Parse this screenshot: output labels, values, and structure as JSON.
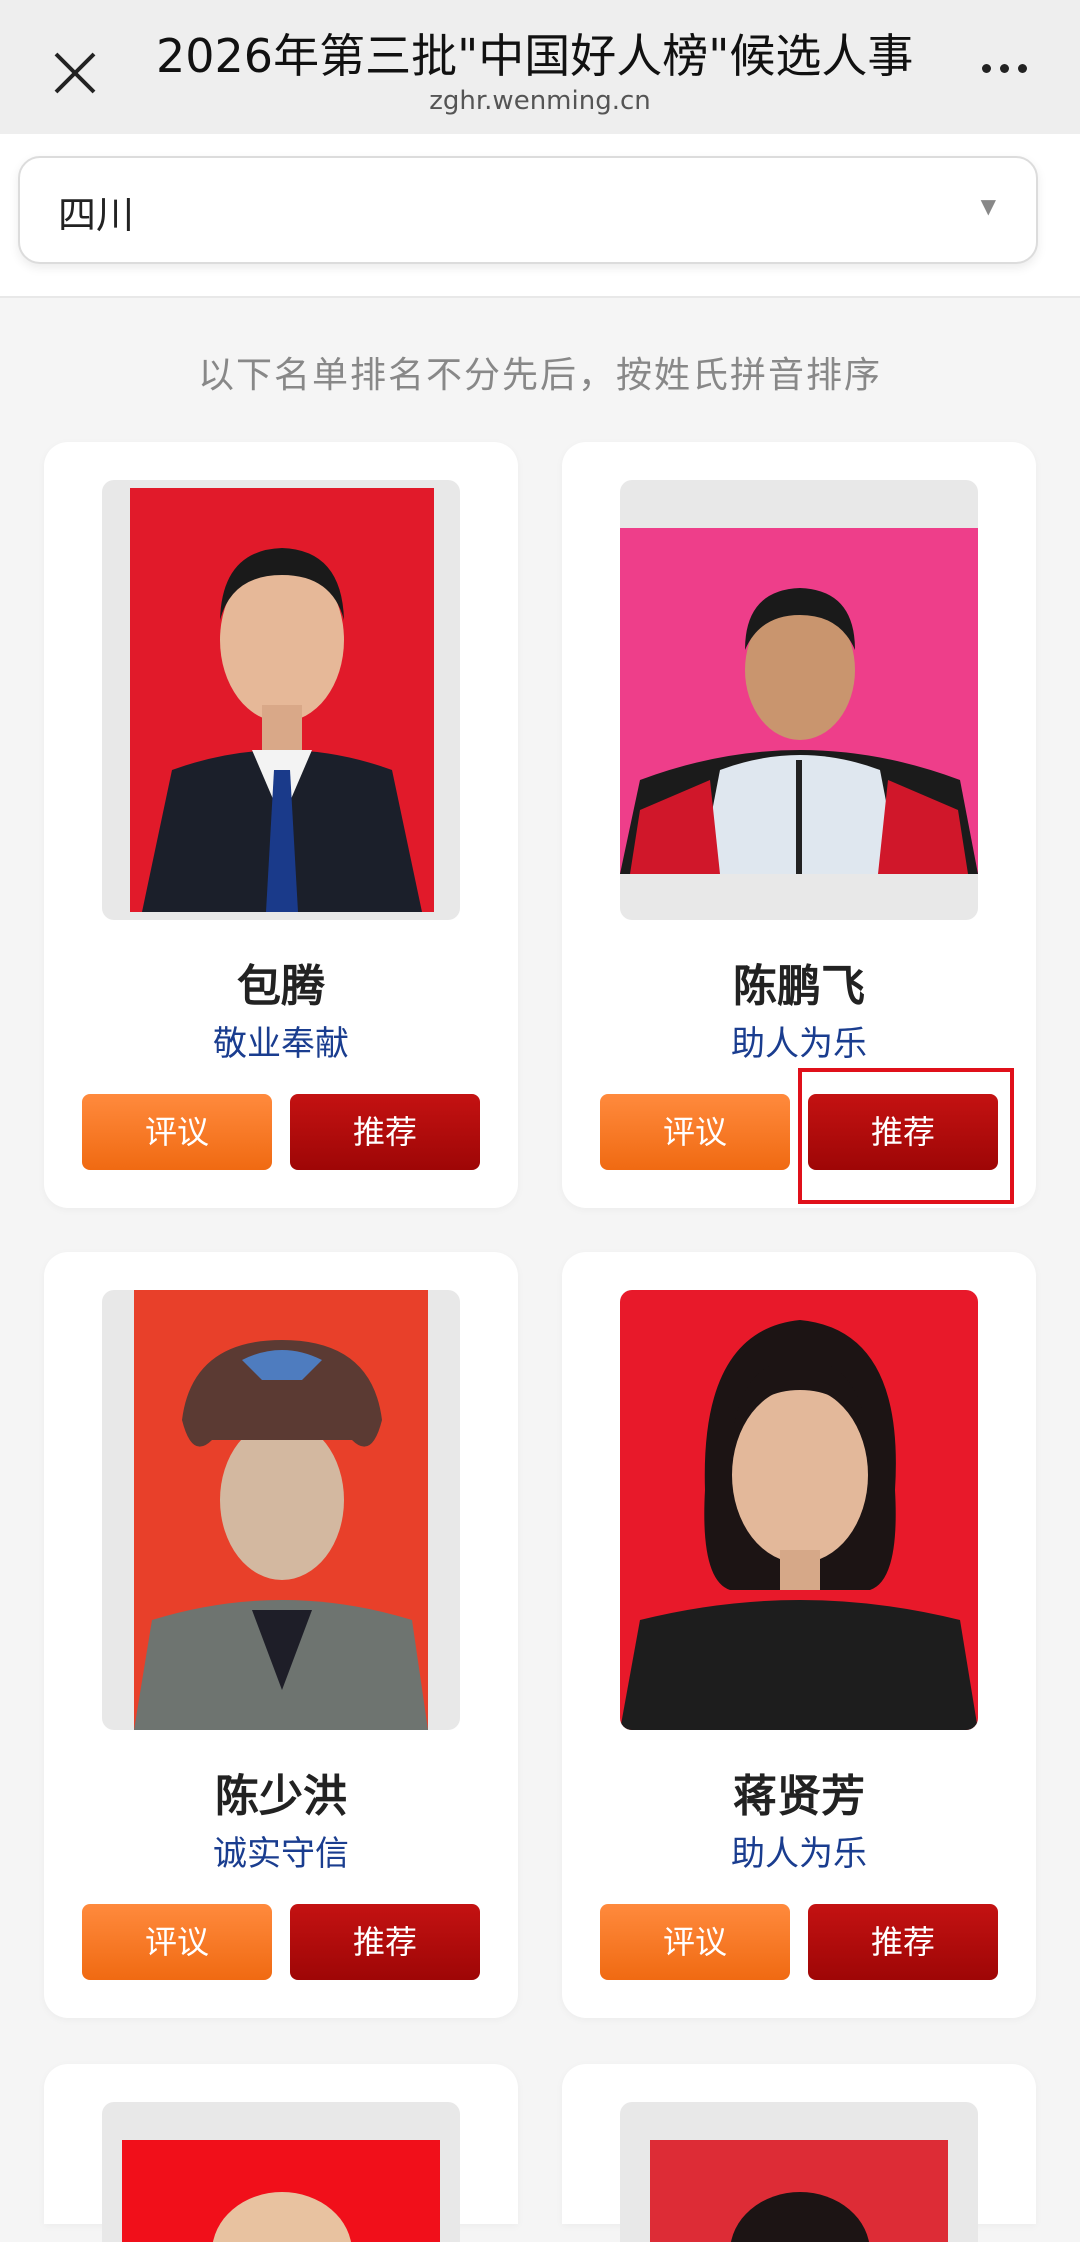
{
  "header": {
    "title": "2026年第三批\"中国好人榜\"候选人事",
    "domain": "zghr.wenming.cn"
  },
  "filter": {
    "selected": "四川"
  },
  "notice": "以下名单排名不分先后，按姓氏拼音排序",
  "buttons": {
    "comment": "评议",
    "recommend": "推荐"
  },
  "candidates": [
    {
      "name": "包腾",
      "category": "敬业奉献"
    },
    {
      "name": "陈鹏飞",
      "category": "助人为乐"
    },
    {
      "name": "陈少洪",
      "category": "诚实守信"
    },
    {
      "name": "蒋贤芳",
      "category": "助人为乐"
    }
  ],
  "colors": {
    "accent_red": "#b00a0a",
    "accent_orange": "#f47a22",
    "category_blue": "#1a3d8f",
    "highlight": "#e0101a"
  }
}
